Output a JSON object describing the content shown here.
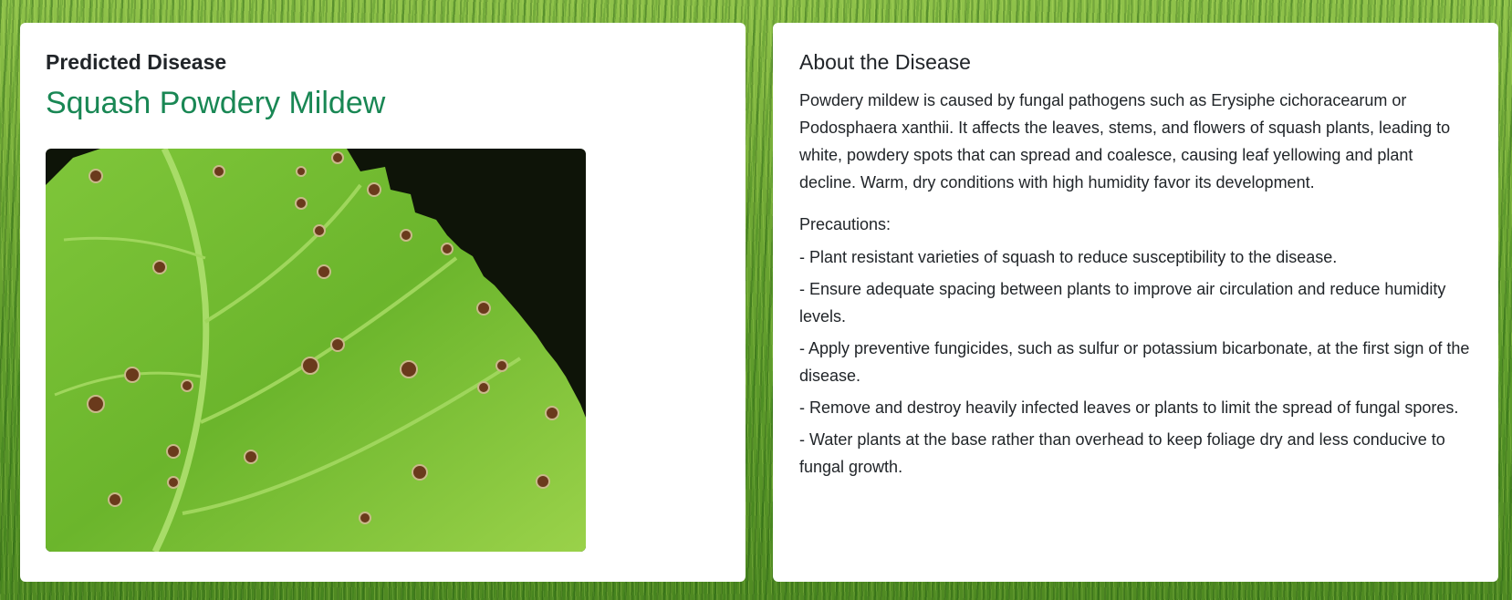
{
  "prediction": {
    "label": "Predicted Disease",
    "disease_name": "Squash Powdery Mildew",
    "accent_color": "#198754"
  },
  "about": {
    "title": "About the Disease",
    "description": "Powdery mildew is caused by fungal pathogens such as Erysiphe cichoracearum or Podosphaera xanthii. It affects the leaves, stems, and flowers of squash plants, leading to white, powdery spots that can spread and coalesce, causing leaf yellowing and plant decline. Warm, dry conditions with high humidity favor its development.",
    "precautions_title": "Precautions:",
    "precautions": [
      "- Plant resistant varieties of squash to reduce susceptibility to the disease.",
      "- Ensure adequate spacing between plants to improve air circulation and reduce humidity levels.",
      "- Apply preventive fungicides, such as sulfur or potassium bicarbonate, at the first sign of the disease.",
      "- Remove and destroy heavily infected leaves or plants to limit the spread of fungal spores.",
      "- Water plants at the base rather than overhead to keep foliage dry and less conducive to fungal growth."
    ]
  },
  "image": {
    "icon": "diseased-leaf-photo"
  }
}
